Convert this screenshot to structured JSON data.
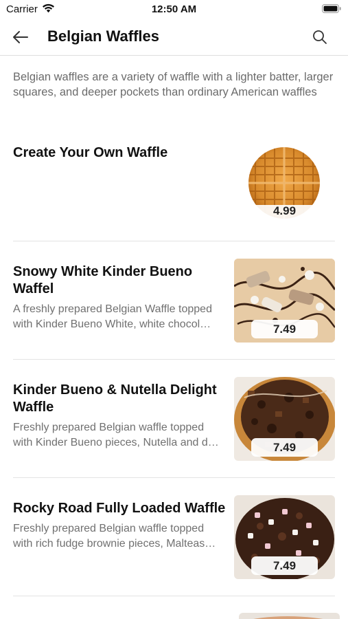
{
  "status_bar": {
    "carrier": "Carrier",
    "time": "12:50 AM"
  },
  "nav": {
    "title": "Belgian Waffles"
  },
  "description": "Belgian waffles are a variety of waffle with a lighter batter, larger squares, and deeper pockets than ordinary American waffles",
  "items": [
    {
      "name": "Create Your Own Waffle",
      "desc_lines": [],
      "price": "4.99"
    },
    {
      "name": "Snowy White Kinder Bueno Waffel",
      "desc_lines": [
        "A freshly prepared Belgian Waffle topped",
        "with Kinder Bueno White, white chocol…"
      ],
      "price": "7.49"
    },
    {
      "name": "Kinder Bueno & Nutella Delight Waffle",
      "desc_lines": [
        "Freshly prepared Belgian waffle topped",
        "with Kinder Bueno pieces, Nutella and d…"
      ],
      "price": "7.49"
    },
    {
      "name": "Rocky Road Fully Loaded Waffle",
      "desc_lines": [
        "Freshly prepared Belgian waffle topped",
        "with rich fudge brownie pieces, Malteas…"
      ],
      "price": "7.49"
    }
  ],
  "colors": {
    "text": "#111111",
    "muted": "#6b6b6b",
    "divider": "#e3e3e3",
    "waffle": "#d98b2b",
    "chocolate": "#3e2417"
  },
  "icons": {
    "back": "arrow-left-icon",
    "search": "search-icon",
    "wifi": "wifi-icon",
    "battery": "battery-icon"
  }
}
